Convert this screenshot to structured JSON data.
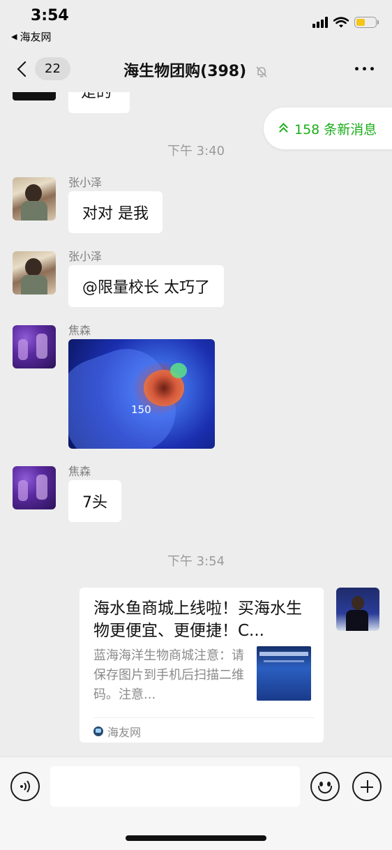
{
  "status_bar": {
    "time": "3:54",
    "back_app": "海友网",
    "battery_color": "#f5c518"
  },
  "nav": {
    "unread_count": "22",
    "title": "海生物团购(398)"
  },
  "chat": {
    "partial_message": "是的",
    "new_messages_label": "158 条新消息",
    "timestamps": [
      "下午 3:40",
      "下午 3:54"
    ],
    "messages": [
      {
        "sender": "张小泽",
        "text": "对对 是我",
        "avatar": "kid-avatar"
      },
      {
        "sender": "张小泽",
        "text": "@限量校长 太巧了",
        "avatar": "kid-avatar"
      },
      {
        "sender": "焦森",
        "type": "image",
        "image_caption": "150",
        "avatar": "coral-avatar"
      },
      {
        "sender": "焦森",
        "text": "7头",
        "avatar": "coral-avatar"
      }
    ],
    "link_card": {
      "title": "海水鱼商城上线啦！买海水生物更便宜、更便捷！C...",
      "description": "蓝海海洋生物商城注意：请保存图片到手机后扫描二维码。注意...",
      "source": "海友网"
    }
  },
  "input_bar": {
    "placeholder": ""
  },
  "colors": {
    "accent_green": "#1aad19",
    "background": "#ededed"
  }
}
